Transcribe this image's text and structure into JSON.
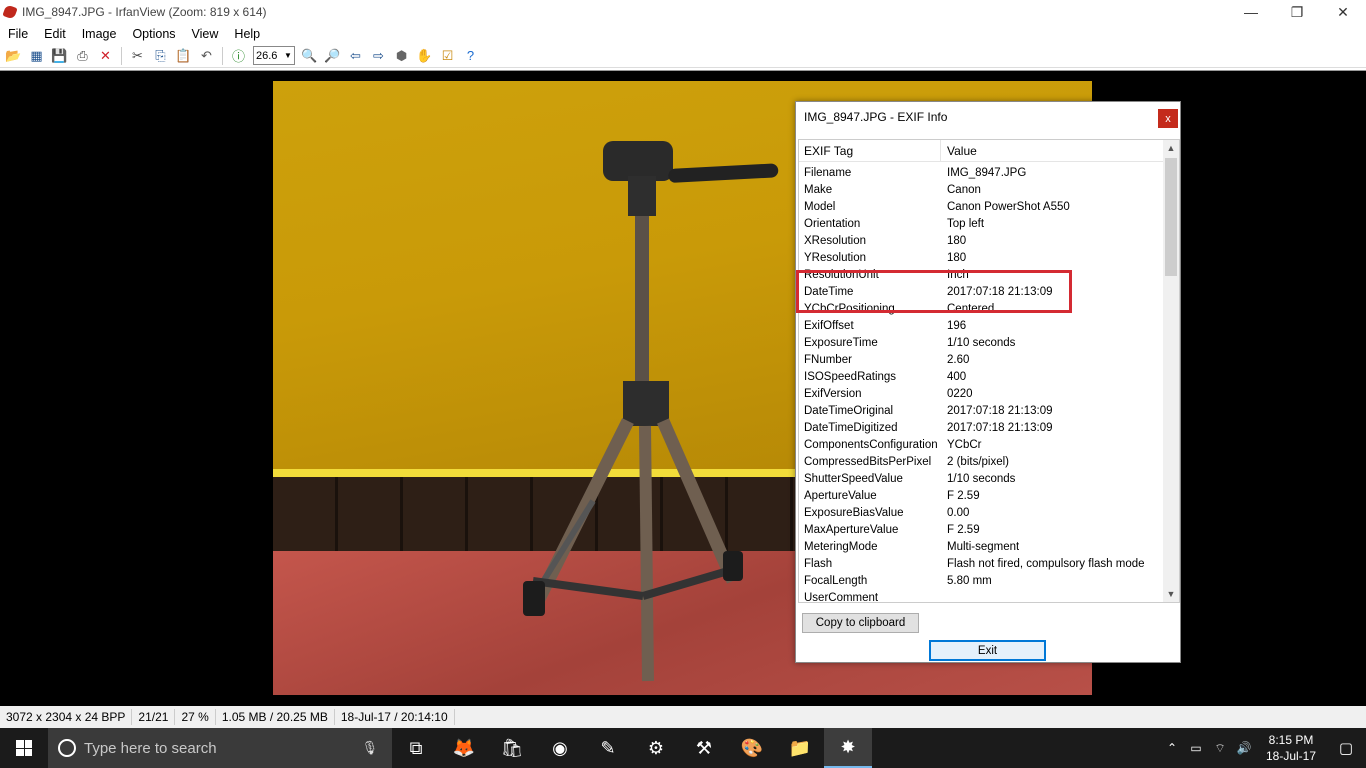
{
  "window": {
    "title": "IMG_8947.JPG - IrfanView (Zoom: 819 x 614)",
    "minimize_glyph": "—",
    "restore_glyph": "❐",
    "close_glyph": "✕"
  },
  "menu": [
    "File",
    "Edit",
    "Image",
    "Options",
    "View",
    "Help"
  ],
  "toolbar": {
    "icons": [
      "open-icon",
      "thumbnails-icon",
      "save-icon",
      "print-icon",
      "delete-icon",
      "cut-icon",
      "copy-icon",
      "paste-icon",
      "undo-icon",
      "info-icon",
      "zoom-combo",
      "zoom-in-icon",
      "zoom-out-icon",
      "previous-icon",
      "next-icon",
      "slideshow-icon",
      "hand-icon",
      "settings-icon",
      "help-icon"
    ],
    "zoom_value": "26.6"
  },
  "status": {
    "dimensions": "3072 x 2304 x 24 BPP",
    "index": "21/21",
    "zoom": "27 %",
    "size": "1.05 MB / 20.25 MB",
    "datetime": "18-Jul-17 / 20:14:10"
  },
  "exif_dialog": {
    "title": "IMG_8947.JPG - EXIF Info",
    "close_label": "x",
    "header_tag": "EXIF Tag",
    "header_value": "Value",
    "rows": [
      {
        "tag": "Filename",
        "value": "IMG_8947.JPG"
      },
      {
        "tag": "Make",
        "value": "Canon"
      },
      {
        "tag": "Model",
        "value": "Canon PowerShot A550"
      },
      {
        "tag": "Orientation",
        "value": "Top left"
      },
      {
        "tag": "XResolution",
        "value": "180"
      },
      {
        "tag": "YResolution",
        "value": "180"
      },
      {
        "tag": "ResolutionUnit",
        "value": "Inch"
      },
      {
        "tag": "DateTime",
        "value": "2017:07:18 21:13:09"
      },
      {
        "tag": "YCbCrPositioning",
        "value": "Centered"
      },
      {
        "tag": "ExifOffset",
        "value": "196"
      },
      {
        "tag": "ExposureTime",
        "value": "1/10 seconds"
      },
      {
        "tag": "FNumber",
        "value": "2.60"
      },
      {
        "tag": "ISOSpeedRatings",
        "value": "400"
      },
      {
        "tag": "ExifVersion",
        "value": "0220"
      },
      {
        "tag": "DateTimeOriginal",
        "value": "2017:07:18 21:13:09"
      },
      {
        "tag": "DateTimeDigitized",
        "value": "2017:07:18 21:13:09"
      },
      {
        "tag": "ComponentsConfiguration",
        "value": "YCbCr"
      },
      {
        "tag": "CompressedBitsPerPixel",
        "value": "2 (bits/pixel)"
      },
      {
        "tag": "ShutterSpeedValue",
        "value": "1/10 seconds"
      },
      {
        "tag": "ApertureValue",
        "value": "F 2.59"
      },
      {
        "tag": "ExposureBiasValue",
        "value": "0.00"
      },
      {
        "tag": "MaxApertureValue",
        "value": "F 2.59"
      },
      {
        "tag": "MeteringMode",
        "value": "Multi-segment"
      },
      {
        "tag": "Flash",
        "value": "Flash not fired, compulsory flash mode"
      },
      {
        "tag": "FocalLength",
        "value": "5.80 mm"
      },
      {
        "tag": "UserComment",
        "value": ""
      }
    ],
    "copy_button": "Copy to clipboard",
    "exit_button": "Exit",
    "highlight_color": "#d42a32"
  },
  "taskbar": {
    "search_placeholder": "Type here to search",
    "apps": [
      {
        "name": "task-view-icon",
        "glyph": "⧉"
      },
      {
        "name": "firefox-icon",
        "glyph": "🦊"
      },
      {
        "name": "store-icon",
        "glyph": "🛍"
      },
      {
        "name": "chrome-icon",
        "glyph": "◉"
      },
      {
        "name": "paint-icon",
        "glyph": "✎"
      },
      {
        "name": "settings-icon",
        "glyph": "⚙"
      },
      {
        "name": "tool-icon",
        "glyph": "⚒"
      },
      {
        "name": "paint-palette-icon",
        "glyph": "🎨"
      },
      {
        "name": "file-explorer-icon",
        "glyph": "📁"
      },
      {
        "name": "irfanview-icon",
        "glyph": "✸"
      }
    ],
    "time": "8:15 PM",
    "date": "18-Jul-17"
  }
}
